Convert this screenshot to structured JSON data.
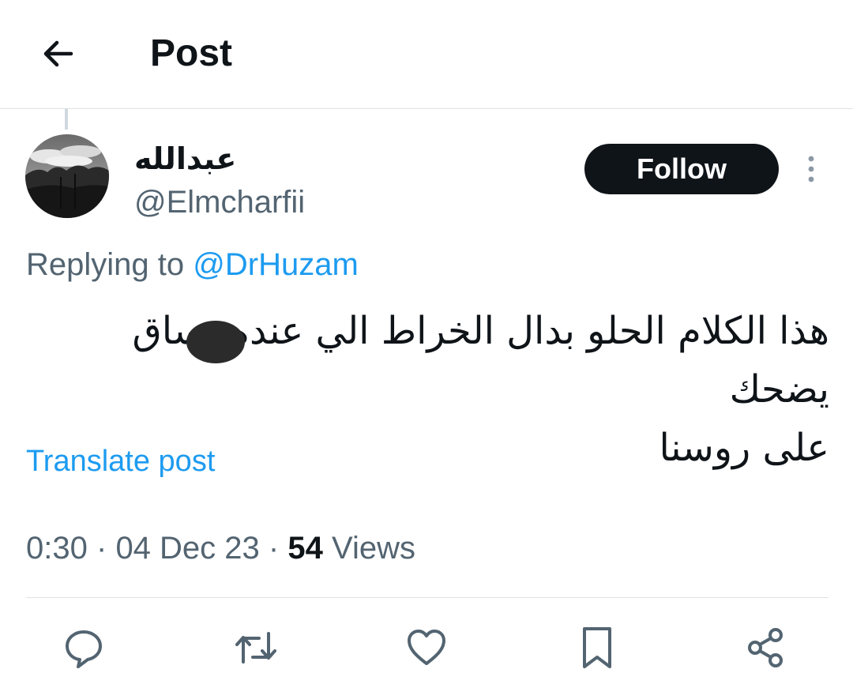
{
  "header": {
    "title": "Post",
    "back_icon": "arrow-left-icon"
  },
  "author": {
    "display_name": "عبدالله",
    "handle": "@Elmcharfii",
    "follow_label": "Follow"
  },
  "replying": {
    "prefix": "Replying to",
    "mention": "@DrHuzam"
  },
  "post": {
    "line1": "هذا الكلام الحلو بدال الخراط الي عنده بساق يضحك",
    "line2": "على روسنا"
  },
  "translate_label": "Translate post",
  "meta": {
    "time": "0:30",
    "separator": "·",
    "date": "04 Dec 23",
    "views_count": "54",
    "views_label": "Views"
  },
  "actions": {
    "reply_icon": "reply-bubble-icon",
    "repost_icon": "repost-icon",
    "like_icon": "heart-icon",
    "bookmark_icon": "bookmark-icon",
    "share_icon": "share-icon"
  },
  "colors": {
    "text_primary": "#0f1419",
    "text_secondary": "#536471",
    "accent": "#1d9bf0",
    "divider": "#dfe3e6"
  }
}
